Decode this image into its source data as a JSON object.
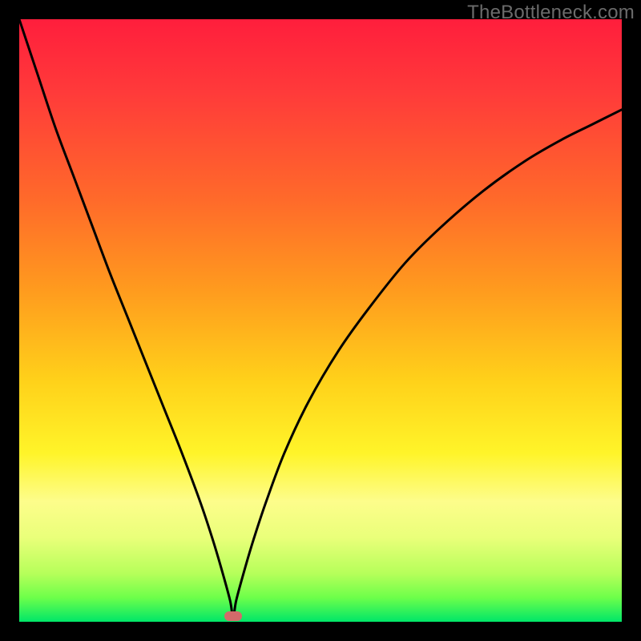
{
  "watermark": "TheBottleneck.com",
  "marker": {
    "x_pct": 35.5,
    "y_pct": 99.1
  },
  "chart_data": {
    "type": "line",
    "title": "",
    "xlabel": "",
    "ylabel": "",
    "xlim": [
      0,
      100
    ],
    "ylim": [
      0,
      100
    ],
    "grid": false,
    "legend": false,
    "series": [
      {
        "name": "curve",
        "x": [
          0,
          3,
          6,
          9,
          12,
          15,
          18,
          21,
          24,
          27,
          30,
          32,
          33.5,
          35,
          35.5,
          36,
          37.5,
          39,
          41,
          44,
          48,
          53,
          58,
          64,
          70,
          77,
          84,
          90,
          95,
          100
        ],
        "y": [
          100,
          91,
          82,
          74,
          66,
          58,
          50.5,
          43,
          35.5,
          28,
          20,
          14,
          9,
          3.5,
          0.5,
          3.5,
          9,
          14,
          20,
          28,
          36.5,
          45,
          52,
          59.5,
          65.5,
          71.5,
          76.5,
          80,
          82.5,
          85
        ]
      }
    ],
    "annotations": [
      {
        "type": "marker",
        "shape": "pill",
        "color": "#d36a6a",
        "x": 35.5,
        "y": 0.9
      }
    ]
  }
}
